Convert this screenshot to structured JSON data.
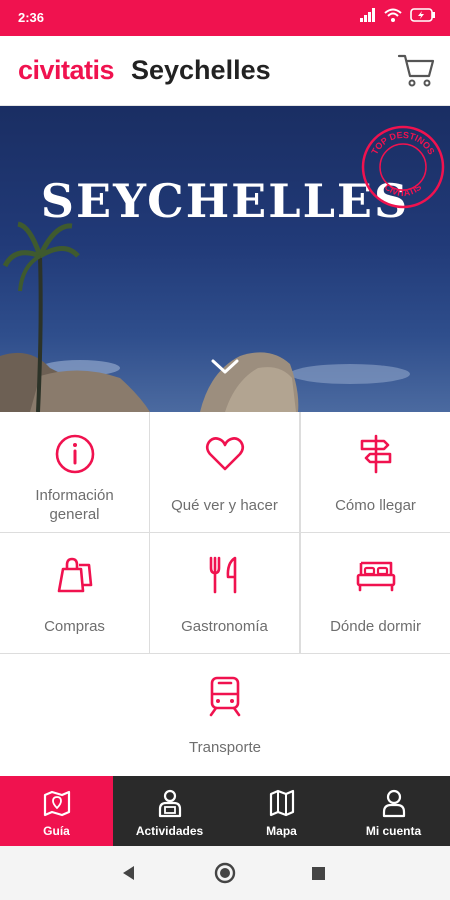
{
  "status_bar": {
    "time": "2:36",
    "icons": [
      "signal-icon",
      "wifi-icon",
      "battery-charging-icon"
    ]
  },
  "header": {
    "brand": "civitatis",
    "title": "Seychelles",
    "cart_icon": "shopping-cart-icon"
  },
  "hero": {
    "title": "SEYCHELLES",
    "badge_top": "TOP DESTINOS",
    "badge_bottom": "CIVITATIS",
    "chevron_icon": "chevron-down-icon"
  },
  "tiles": [
    {
      "label": "Información general",
      "icon": "info-icon"
    },
    {
      "label": "Qué ver y hacer",
      "icon": "heart-icon"
    },
    {
      "label": "Cómo llegar",
      "icon": "signpost-icon"
    },
    {
      "label": "Compras",
      "icon": "shopping-bag-icon"
    },
    {
      "label": "Gastronomía",
      "icon": "fork-knife-icon"
    },
    {
      "label": "Dónde dormir",
      "icon": "bed-icon"
    },
    {
      "label": "Transporte",
      "icon": "train-icon"
    }
  ],
  "bottom_nav": [
    {
      "label": "Guía",
      "icon": "map-guide-icon",
      "active": true
    },
    {
      "label": "Actividades",
      "icon": "guide-person-icon",
      "active": false
    },
    {
      "label": "Mapa",
      "icon": "map-icon",
      "active": false
    },
    {
      "label": "Mi cuenta",
      "icon": "user-icon",
      "active": false
    }
  ],
  "colors": {
    "accent": "#f0124f",
    "nav_background": "#2a2a2a",
    "label_gray": "#6e6e6e"
  }
}
